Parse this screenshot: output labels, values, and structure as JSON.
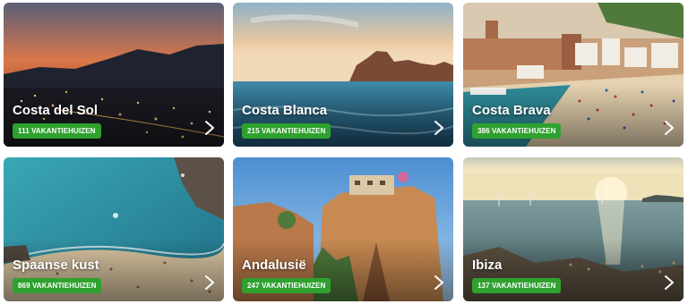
{
  "cards": [
    {
      "name": "Costa del Sol",
      "count": "111 VAKANTIEHUIZEN"
    },
    {
      "name": "Costa Blanca",
      "count": "215 VAKANTIEHUIZEN"
    },
    {
      "name": "Costa Brava",
      "count": "386 VAKANTIEHUIZEN"
    },
    {
      "name": "Spaanse kust",
      "count": "869 VAKANTIEHUIZEN"
    },
    {
      "name": "Andalusië",
      "count": "247 VAKANTIEHUIZEN"
    },
    {
      "name": "Ibiza",
      "count": "137 VAKANTIEHUIZEN"
    }
  ],
  "colors": {
    "badge": "#2fa12f",
    "title": "#ffffff"
  },
  "icons": {
    "arrow": "chevron-right-icon"
  }
}
